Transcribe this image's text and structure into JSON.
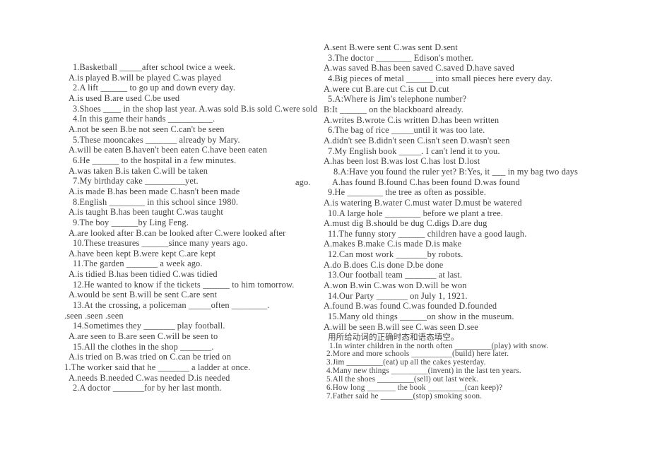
{
  "document": {
    "type": "english-grammar-worksheet",
    "background_color": "#ffffff",
    "text_color": "#3f3f3f"
  },
  "left_column": {
    "lines": [
      {
        "id": "l1",
        "style": "stem",
        "text": "1.Basketball _____after school twice a week."
      },
      {
        "id": "l2",
        "style": "opt",
        "text": "A.is played B.will be played C.was played"
      },
      {
        "id": "l3",
        "style": "stem",
        "text": "2.A lift ______ to go up and down every day."
      },
      {
        "id": "l4",
        "style": "opt",
        "text": "A.is used B.are used C.be used"
      },
      {
        "id": "l5",
        "style": "stem",
        "text": "3.Shoes ____ in the shop last year. A.was sold B.is sold C.were sold"
      },
      {
        "id": "l6",
        "style": "stem",
        "text": "4.In this game their hands __________."
      },
      {
        "id": "l7",
        "style": "opt",
        "text": "A.not be seen B.be not seen C.can't be seen"
      },
      {
        "id": "l8",
        "style": "stem",
        "text": "5.These mooncakes _______ already by Mary."
      },
      {
        "id": "l9",
        "style": "opt",
        "text": "A.will be eaten B.haven't been eaten C.have been eaten"
      },
      {
        "id": "l10",
        "style": "stem",
        "text": "6.He ______ to the hospital in a few minutes."
      },
      {
        "id": "l11",
        "style": "opt",
        "text": "A.was taken B.is taken C.will be taken"
      },
      {
        "id": "l12",
        "style": "stem",
        "text": "7.My birthday cake _________yet."
      },
      {
        "id": "l13",
        "style": "opt",
        "text": "A.is made B.has been made C.hasn't been made"
      },
      {
        "id": "l14",
        "style": "stem",
        "text": "8.English ________ in this school since 1980."
      },
      {
        "id": "l15",
        "style": "opt",
        "text": "A.is taught B.has been taught C.was taught"
      },
      {
        "id": "l16",
        "style": "stem",
        "text": "9.The boy ______by Ling Feng."
      },
      {
        "id": "l17",
        "style": "opt",
        "text": "A.are looked after B.can be looked after C.were looked after"
      },
      {
        "id": "l18",
        "style": "stem",
        "text": "10.These treasures ______since many years ago."
      },
      {
        "id": "l19",
        "style": "opt",
        "text": "A.have been kept B.were kept C.are kept"
      },
      {
        "id": "l20",
        "style": "stem",
        "text": "11.The garden _______ a week ago."
      },
      {
        "id": "l21",
        "style": "opt",
        "text": "A.is tidied B.has been tidied C.was tidied"
      },
      {
        "id": "l22",
        "style": "stem",
        "text": "12.He wanted to know if the tickets ______ to him tomorrow."
      },
      {
        "id": "l23",
        "style": "opt",
        "text": "A.would be sent B.will be sent C.are sent"
      },
      {
        "id": "l24",
        "style": "stem",
        "text": "13.At the crossing, a policeman _____often ________."
      },
      {
        "id": "l25",
        "style": "outdent",
        "text": ".seen .seen .seen"
      },
      {
        "id": "l26",
        "style": "stem",
        "text": "14.Sometimes they _______ play football."
      },
      {
        "id": "l27",
        "style": "opt",
        "text": "A.are seen to B.are seen C.will be seen to"
      },
      {
        "id": "l28",
        "style": "stem",
        "text": "15.All the clothes in the shop _______."
      },
      {
        "id": "l29",
        "style": "opt",
        "text": "A.is tried on B.was tried on C.can be tried on"
      },
      {
        "id": "l30",
        "style": "outdent",
        "text": "1.The worker said that he _______ a ladder at once."
      },
      {
        "id": "l31",
        "style": "opt",
        "text": "A.needs B.needed C.was needed D.is needed"
      },
      {
        "id": "l32",
        "style": "stem",
        "text": "2.A doctor _______for by her last month."
      }
    ]
  },
  "right_column": {
    "lines": [
      {
        "id": "r1",
        "style": "opt",
        "text": "A.sent B.were sent C.was sent D.sent"
      },
      {
        "id": "r2",
        "style": "stem",
        "text": "3.The doctor ________ Edison's mother."
      },
      {
        "id": "r3",
        "style": "opt",
        "text": "A.was saved B.has been saved C.saved D.have saved"
      },
      {
        "id": "r4",
        "style": "stem",
        "text": "4.Big pieces of metal ______ into small pieces here every day."
      },
      {
        "id": "r5",
        "style": "opt",
        "text": "A.were cut B.are cut C.is cut D.cut"
      },
      {
        "id": "r6",
        "style": "stem",
        "text": "5.A:Where is Jim's telephone number?"
      },
      {
        "id": "r7",
        "style": "opt",
        "text": "B:It ______ on the blackboard already."
      },
      {
        "id": "r8",
        "style": "opt",
        "text": "A.writes B.wrote C.is written D.has been written"
      },
      {
        "id": "r9",
        "style": "stem",
        "text": "6.The bag of rice _____until it was too late."
      },
      {
        "id": "r10",
        "style": "opt",
        "text": "A.didn't see B.didn't seen C.isn't seen D.wasn't seen"
      },
      {
        "id": "r11",
        "style": "stem",
        "text": "7.My English book _____. I can't lend it to you."
      },
      {
        "id": "r12",
        "style": "opt",
        "text": "A.has been lost B.was lost C.has lost D.lost"
      },
      {
        "id": "r13",
        "style": "indent-extra",
        "text": "8.A:Have you found the ruler yet? B:Yes, it ___ in my bag two days"
      },
      {
        "id": "r14",
        "style": "hang",
        "head": "ago.",
        "text": "A.has found B.found C.has been found D.was found"
      },
      {
        "id": "r15",
        "style": "stem",
        "text": "9.He ________ the tree as often as possible."
      },
      {
        "id": "r16",
        "style": "opt",
        "text": "A.is watering B.water C.must water D.must be watered"
      },
      {
        "id": "r17",
        "style": "stem",
        "text": "10.A large hole ________ before we plant a tree."
      },
      {
        "id": "r18",
        "style": "opt",
        "text": "A.must dig B.should be dug C.digs D.are dug"
      },
      {
        "id": "r19",
        "style": "stem",
        "text": "11.The funny story ______ children have a good laugh."
      },
      {
        "id": "r20",
        "style": "opt",
        "text": "A.makes B.make C.is made D.is make"
      },
      {
        "id": "r21",
        "style": "stem",
        "text": "12.Can most work _______by robots."
      },
      {
        "id": "r22",
        "style": "opt",
        "text": "A.do B.does C.is done D.be done"
      },
      {
        "id": "r23",
        "style": "stem",
        "text": "13.Our football team _______ at last."
      },
      {
        "id": "r24",
        "style": "opt",
        "text": "A.won B.win C.was won D.will be won"
      },
      {
        "id": "r25",
        "style": "stem",
        "text": "14.Our Party _______ on July 1, 1921."
      },
      {
        "id": "r26",
        "style": "opt",
        "text": "A.found B.was found C.was founded D.founded"
      },
      {
        "id": "r27",
        "style": "stem",
        "text": "15.Many old things ______on show in the museum."
      },
      {
        "id": "r28",
        "style": "opt",
        "text": "A.will be seen B.will see C.was seen D.see"
      }
    ],
    "section_instruction": "用所给动词的正确时态和语态填空。",
    "fill_in_items": [
      {
        "id": "f1",
        "text": "1.In winter children in the north often _________(play) with snow."
      },
      {
        "id": "f2",
        "text": "2.More and more schools __________(build) here later."
      },
      {
        "id": "f3",
        "text": "3.Jim _________(eat) up all the cakes yesterday."
      },
      {
        "id": "f4",
        "text": "4.Many new things _________(invent) in the last ten years."
      },
      {
        "id": "f5",
        "text": "5.All the shoes _________(sell) out last week."
      },
      {
        "id": "f6",
        "text": "6.How long _______ the book _________(can keep)?"
      },
      {
        "id": "f7",
        "text": "7.Father said he ________(stop) smoking soon."
      }
    ]
  }
}
